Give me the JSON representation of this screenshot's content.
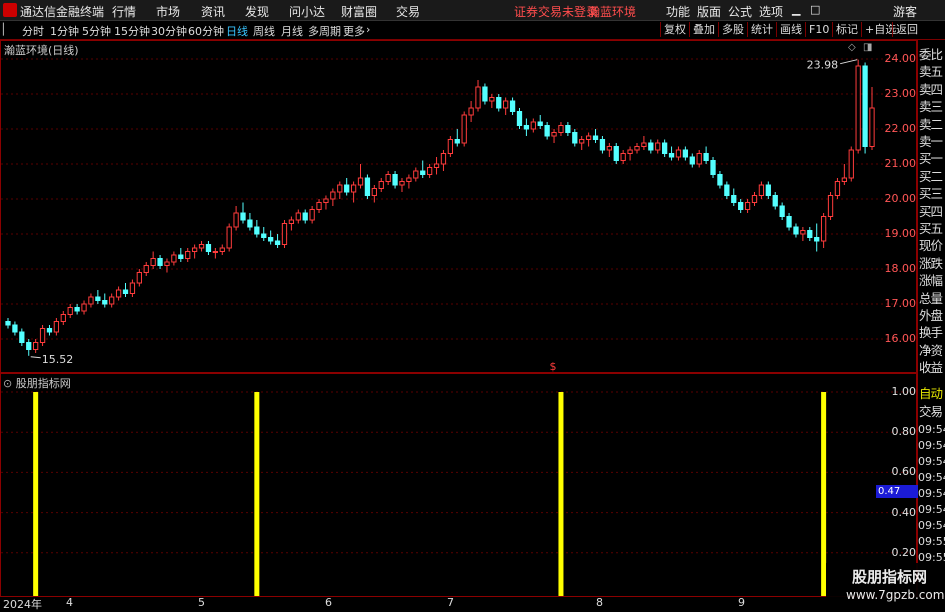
{
  "menubar": {
    "app_name": "通达信金融终端",
    "items": [
      "行情",
      "市场",
      "资讯",
      "发现",
      "问小达",
      "财富圈",
      "交易"
    ],
    "status": "证券交易未登录",
    "status2": "瀚蓝环境",
    "right_items": [
      "功能",
      "版面",
      "公式",
      "选项"
    ],
    "guest": "游客",
    "colors": {
      "status": "#ff4d4d"
    }
  },
  "periodbar": {
    "tabs": [
      "分时",
      "1分钟",
      "5分钟",
      "15分钟",
      "30分钟",
      "60分钟",
      "日线",
      "周线",
      "月线",
      "多周期",
      "更多"
    ],
    "active_tab": "日线",
    "more_arrow": "chevron-right-icon",
    "right_tools": [
      "复权",
      "叠加",
      "多股",
      "统计",
      "画线",
      "F10",
      "标记",
      "+自选",
      "返回"
    ]
  },
  "main_chart": {
    "stock_label": "瀚蓝环境(日线)",
    "high_label": "23.98",
    "low_label": "15.52",
    "marker": "$",
    "right_side_labels": [
      "委比",
      "卖五",
      "卖四",
      "卖三",
      "卖二",
      "卖一",
      "买一",
      "买二",
      "买三",
      "买四",
      "买五",
      "现价",
      "涨跌",
      "涨幅",
      "总量",
      "外盘",
      "换手",
      "净资",
      "收益"
    ],
    "y_ticks": [
      "24.00",
      "23.00",
      "22.00",
      "21.00",
      "20.00",
      "19.00",
      "18.00",
      "17.00",
      "16.00"
    ]
  },
  "sub_chart": {
    "title": "股朋指标网",
    "y_ticks": [
      "1.00",
      "0.80",
      "0.60",
      "0.40",
      "0.20"
    ],
    "current_value": "0.47",
    "right_side_labels": [
      "自动",
      "交易"
    ],
    "time_ticks": [
      "09:54",
      "09:54",
      "09:54",
      "09:54",
      "09:54",
      "09:54",
      "09:54",
      "09:55",
      "09:55"
    ]
  },
  "date_axis": {
    "labels": [
      "2024年",
      "4",
      "5",
      "6",
      "7",
      "8",
      "9"
    ]
  },
  "watermark": {
    "line1": "股朋指标网",
    "line2": "www.7gpzb.com"
  },
  "chart_data": {
    "type": "candlestick",
    "price_range": [
      15.3,
      24.3
    ],
    "colors": {
      "up": "#ff3c3c",
      "down": "#54ffff",
      "signal": "#ffff00"
    },
    "candles": [
      [
        16.5,
        16.6,
        16.3,
        16.4
      ],
      [
        16.4,
        16.5,
        16.1,
        16.2
      ],
      [
        16.2,
        16.3,
        15.8,
        15.9
      ],
      [
        15.9,
        16.0,
        15.52,
        15.7
      ],
      [
        15.7,
        16.0,
        15.6,
        15.9
      ],
      [
        15.9,
        16.4,
        15.8,
        16.3
      ],
      [
        16.3,
        16.4,
        16.1,
        16.2
      ],
      [
        16.2,
        16.6,
        16.1,
        16.5
      ],
      [
        16.5,
        16.8,
        16.4,
        16.7
      ],
      [
        16.7,
        17.0,
        16.6,
        16.9
      ],
      [
        16.9,
        17.0,
        16.7,
        16.8
      ],
      [
        16.8,
        17.1,
        16.7,
        17.0
      ],
      [
        17.0,
        17.3,
        16.9,
        17.2
      ],
      [
        17.2,
        17.4,
        17.0,
        17.1
      ],
      [
        17.1,
        17.3,
        16.9,
        17.0
      ],
      [
        17.0,
        17.3,
        16.9,
        17.2
      ],
      [
        17.2,
        17.5,
        17.1,
        17.4
      ],
      [
        17.4,
        17.6,
        17.2,
        17.3
      ],
      [
        17.3,
        17.7,
        17.2,
        17.6
      ],
      [
        17.6,
        18.0,
        17.5,
        17.9
      ],
      [
        17.9,
        18.2,
        17.8,
        18.1
      ],
      [
        18.1,
        18.5,
        18.0,
        18.3
      ],
      [
        18.3,
        18.4,
        18.0,
        18.1
      ],
      [
        18.1,
        18.3,
        17.9,
        18.2
      ],
      [
        18.2,
        18.5,
        18.1,
        18.4
      ],
      [
        18.4,
        18.6,
        18.2,
        18.3
      ],
      [
        18.3,
        18.6,
        18.2,
        18.5
      ],
      [
        18.5,
        18.7,
        18.3,
        18.6
      ],
      [
        18.6,
        18.8,
        18.5,
        18.7
      ],
      [
        18.7,
        18.8,
        18.4,
        18.5
      ],
      [
        18.5,
        18.6,
        18.3,
        18.5
      ],
      [
        18.5,
        18.7,
        18.4,
        18.6
      ],
      [
        18.6,
        19.3,
        18.5,
        19.2
      ],
      [
        19.2,
        19.8,
        19.1,
        19.6
      ],
      [
        19.6,
        19.9,
        19.3,
        19.4
      ],
      [
        19.4,
        19.6,
        19.1,
        19.2
      ],
      [
        19.2,
        19.4,
        18.9,
        19.0
      ],
      [
        19.0,
        19.2,
        18.8,
        18.9
      ],
      [
        18.9,
        19.1,
        18.7,
        18.8
      ],
      [
        18.8,
        19.0,
        18.6,
        18.7
      ],
      [
        18.7,
        19.4,
        18.6,
        19.3
      ],
      [
        19.3,
        19.5,
        19.1,
        19.4
      ],
      [
        19.4,
        19.7,
        19.3,
        19.6
      ],
      [
        19.6,
        19.7,
        19.3,
        19.4
      ],
      [
        19.4,
        19.8,
        19.3,
        19.7
      ],
      [
        19.7,
        20.0,
        19.6,
        19.9
      ],
      [
        19.9,
        20.1,
        19.7,
        20.0
      ],
      [
        20.0,
        20.3,
        19.8,
        20.2
      ],
      [
        20.2,
        20.5,
        20.0,
        20.4
      ],
      [
        20.4,
        20.6,
        20.1,
        20.2
      ],
      [
        20.2,
        20.5,
        19.9,
        20.4
      ],
      [
        20.4,
        21.0,
        20.3,
        20.6
      ],
      [
        20.6,
        20.7,
        20.0,
        20.1
      ],
      [
        20.1,
        20.4,
        19.9,
        20.3
      ],
      [
        20.3,
        20.6,
        20.2,
        20.5
      ],
      [
        20.5,
        20.8,
        20.4,
        20.7
      ],
      [
        20.7,
        20.8,
        20.3,
        20.4
      ],
      [
        20.4,
        20.6,
        20.2,
        20.5
      ],
      [
        20.5,
        20.7,
        20.3,
        20.6
      ],
      [
        20.6,
        20.9,
        20.5,
        20.8
      ],
      [
        20.8,
        21.1,
        20.6,
        20.7
      ],
      [
        20.7,
        21.0,
        20.6,
        20.9
      ],
      [
        20.9,
        21.2,
        20.7,
        21.0
      ],
      [
        21.0,
        21.4,
        20.8,
        21.3
      ],
      [
        21.3,
        21.8,
        21.2,
        21.7
      ],
      [
        21.7,
        22.0,
        21.5,
        21.6
      ],
      [
        21.6,
        22.5,
        21.5,
        22.4
      ],
      [
        22.4,
        22.8,
        22.2,
        22.6
      ],
      [
        22.6,
        23.4,
        22.5,
        23.2
      ],
      [
        23.2,
        23.3,
        22.7,
        22.8
      ],
      [
        22.8,
        23.0,
        22.6,
        22.9
      ],
      [
        22.9,
        23.0,
        22.5,
        22.6
      ],
      [
        22.6,
        22.9,
        22.4,
        22.8
      ],
      [
        22.8,
        22.9,
        22.4,
        22.5
      ],
      [
        22.5,
        22.6,
        22.0,
        22.1
      ],
      [
        22.1,
        22.3,
        21.8,
        22.0
      ],
      [
        22.0,
        22.3,
        21.9,
        22.2
      ],
      [
        22.2,
        22.4,
        22.0,
        22.1
      ],
      [
        22.1,
        22.2,
        21.7,
        21.8
      ],
      [
        21.8,
        22.0,
        21.6,
        21.9
      ],
      [
        21.9,
        22.2,
        21.8,
        22.1
      ],
      [
        22.1,
        22.2,
        21.8,
        21.9
      ],
      [
        21.9,
        22.0,
        21.5,
        21.6
      ],
      [
        21.6,
        21.8,
        21.4,
        21.7
      ],
      [
        21.7,
        21.9,
        21.5,
        21.8
      ],
      [
        21.8,
        22.0,
        21.6,
        21.7
      ],
      [
        21.7,
        21.8,
        21.3,
        21.4
      ],
      [
        21.4,
        21.6,
        21.2,
        21.5
      ],
      [
        21.5,
        21.6,
        21.0,
        21.1
      ],
      [
        21.1,
        21.4,
        21.0,
        21.3
      ],
      [
        21.3,
        21.5,
        21.1,
        21.4
      ],
      [
        21.4,
        21.6,
        21.3,
        21.5
      ],
      [
        21.5,
        21.8,
        21.4,
        21.6
      ],
      [
        21.6,
        21.7,
        21.3,
        21.4
      ],
      [
        21.4,
        21.7,
        21.3,
        21.6
      ],
      [
        21.6,
        21.7,
        21.2,
        21.3
      ],
      [
        21.3,
        21.5,
        21.1,
        21.2
      ],
      [
        21.2,
        21.5,
        21.1,
        21.4
      ],
      [
        21.4,
        21.5,
        21.1,
        21.2
      ],
      [
        21.2,
        21.3,
        20.9,
        21.0
      ],
      [
        21.0,
        21.4,
        20.9,
        21.3
      ],
      [
        21.3,
        21.5,
        21.0,
        21.1
      ],
      [
        21.1,
        21.2,
        20.6,
        20.7
      ],
      [
        20.7,
        20.8,
        20.3,
        20.4
      ],
      [
        20.4,
        20.5,
        20.0,
        20.1
      ],
      [
        20.1,
        20.3,
        19.8,
        19.9
      ],
      [
        19.9,
        20.0,
        19.6,
        19.7
      ],
      [
        19.7,
        20.0,
        19.6,
        19.9
      ],
      [
        19.9,
        20.2,
        19.8,
        20.1
      ],
      [
        20.1,
        20.5,
        20.0,
        20.4
      ],
      [
        20.4,
        20.5,
        20.0,
        20.1
      ],
      [
        20.1,
        20.2,
        19.7,
        19.8
      ],
      [
        19.8,
        19.9,
        19.4,
        19.5
      ],
      [
        19.5,
        19.6,
        19.1,
        19.2
      ],
      [
        19.2,
        19.3,
        18.9,
        19.0
      ],
      [
        19.0,
        19.2,
        18.8,
        19.1
      ],
      [
        19.1,
        19.2,
        18.8,
        18.9
      ],
      [
        18.9,
        19.3,
        18.5,
        18.8
      ],
      [
        18.8,
        19.6,
        18.6,
        19.5
      ],
      [
        19.5,
        20.2,
        19.4,
        20.1
      ],
      [
        20.1,
        20.6,
        20.0,
        20.5
      ],
      [
        20.5,
        21.0,
        20.4,
        20.6
      ],
      [
        20.6,
        21.5,
        20.5,
        21.4
      ],
      [
        21.4,
        23.98,
        21.3,
        23.8
      ],
      [
        23.8,
        23.9,
        21.3,
        21.5
      ],
      [
        21.5,
        23.2,
        21.4,
        22.6
      ]
    ],
    "signal_bars": [
      {
        "candle_index": 4,
        "value": 1.0
      },
      {
        "candle_index": 36,
        "value": 1.0
      },
      {
        "candle_index": 80,
        "value": 1.0
      },
      {
        "candle_index": 118,
        "value": 1.0
      }
    ],
    "signal_ylim": [
      0.12,
      1.06
    ]
  }
}
